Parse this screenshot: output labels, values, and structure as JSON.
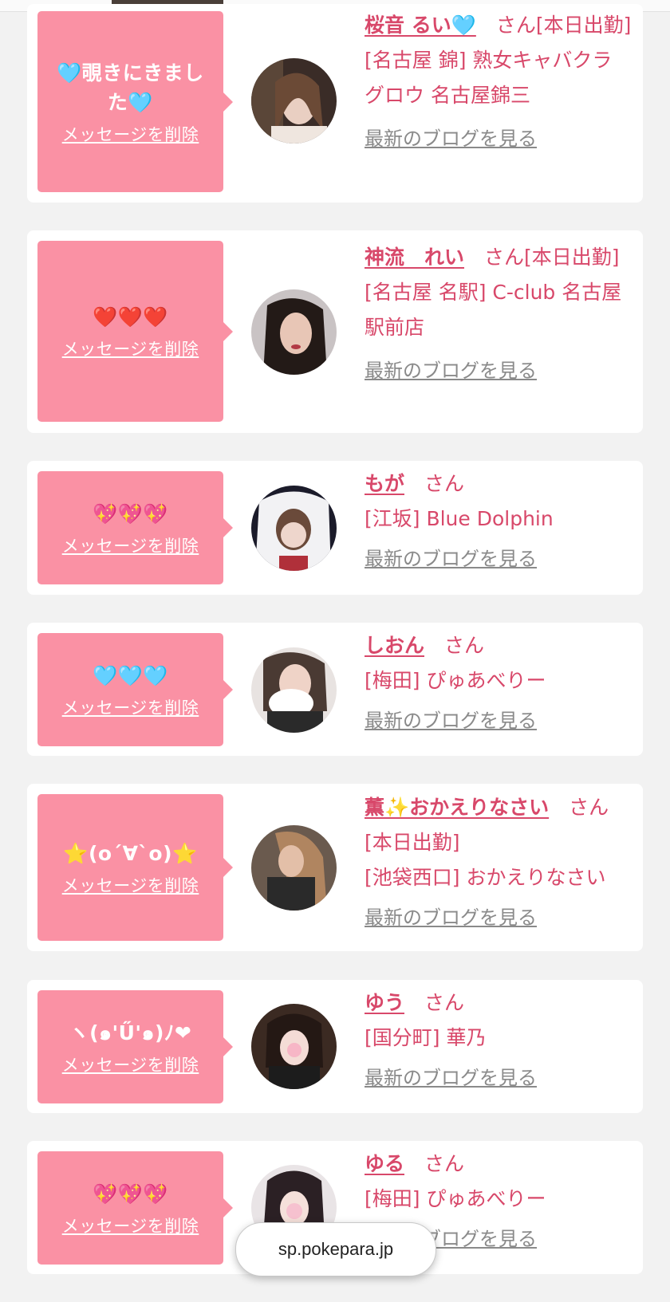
{
  "delete_label": "メッセージを削除",
  "blog_label": "最新のブログを見る",
  "url": "sp.pokepara.jp",
  "colors": {
    "bubble": "#fa91a4",
    "accent": "#d8486a",
    "muted": "#8a8a8a"
  },
  "cards": [
    {
      "message": "🩵覗きにきました🩵",
      "name": "桜音 るい🩵",
      "suffix": "さん",
      "line1": "[本日出勤]",
      "shop": "[名古屋 錦] 熟女キャバクラグロウ 名古屋錦三"
    },
    {
      "message": "❤️❤️❤️",
      "name": "神流　れい",
      "suffix": "さん",
      "line1": "[本日出勤]",
      "shop": "[名古屋 名駅] C-club 名古屋駅前店"
    },
    {
      "message": "💖💖💖",
      "name": "もが",
      "suffix": "さん",
      "line1": "",
      "shop": "[江坂] Blue Dolphin"
    },
    {
      "message": "🩵🩵🩵",
      "name": "しおん",
      "suffix": "さん",
      "line1": "",
      "shop": "[梅田] ぴゅあべりー"
    },
    {
      "message": "⭐(o´∀`o)⭐",
      "name": "薫✨おかえりなさい",
      "suffix": "さん",
      "line1": "[本日出勤]",
      "shop": "[池袋西口] おかえりなさい"
    },
    {
      "message": "ヽ(๑'Ű'๑)ﾉ❤",
      "name": "ゆう",
      "suffix": "さん",
      "line1": "",
      "shop": "[国分町] 華乃"
    },
    {
      "message": "💖💖💖",
      "name": "ゆる",
      "suffix": "さん",
      "line1": "",
      "shop": "[梅田] ぴゅあべりー"
    }
  ]
}
